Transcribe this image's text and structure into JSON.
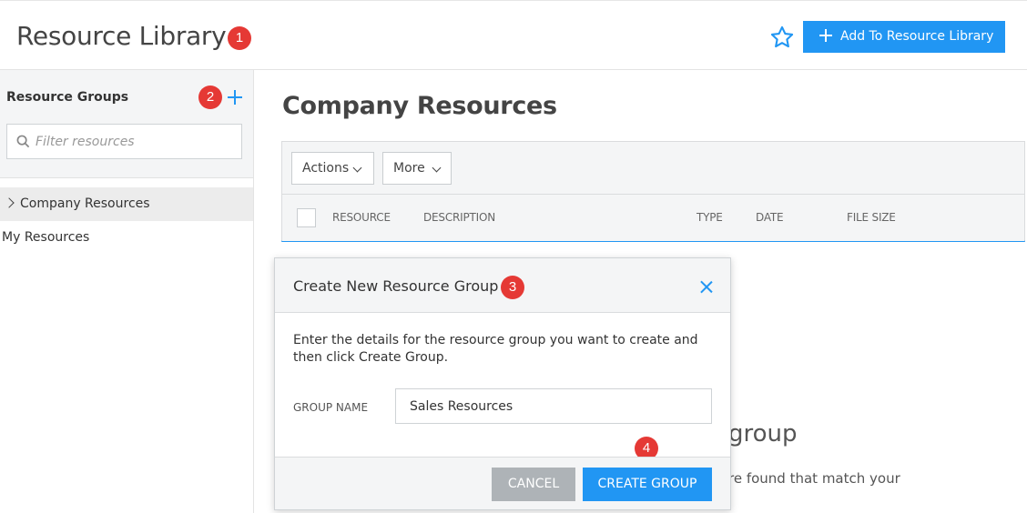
{
  "header": {
    "title": "Resource Library",
    "add_button_label": "Add To Resource Library",
    "star_icon": "star-outline-icon"
  },
  "annotations": [
    "1",
    "2",
    "3",
    "4"
  ],
  "sidebar": {
    "groups_title": "Resource Groups",
    "filter_placeholder": "Filter resources",
    "items": [
      {
        "label": "Company Resources",
        "active": true,
        "icon": "chevron-right-icon"
      },
      {
        "label": "My Resources",
        "active": false
      }
    ]
  },
  "main": {
    "title": "Company Resources",
    "toolbar": {
      "actions_label": "Actions",
      "more_label": "More"
    },
    "columns": [
      "RESOURCE",
      "DESCRIPTION",
      "TYPE",
      "DATE",
      "FILE SIZE"
    ],
    "empty_title_partial": "group",
    "empty_text_partial": "re found that match your"
  },
  "modal": {
    "title": "Create New Resource Group",
    "description": "Enter the details for the resource group you want to create and then click Create Group.",
    "field_label": "GROUP NAME",
    "field_value": "Sales Resources",
    "cancel_label": "CANCEL",
    "create_label": "CREATE GROUP"
  },
  "colors": {
    "accent": "#2196f3",
    "badge": "#e53935",
    "cancel": "#aeb3b7"
  }
}
